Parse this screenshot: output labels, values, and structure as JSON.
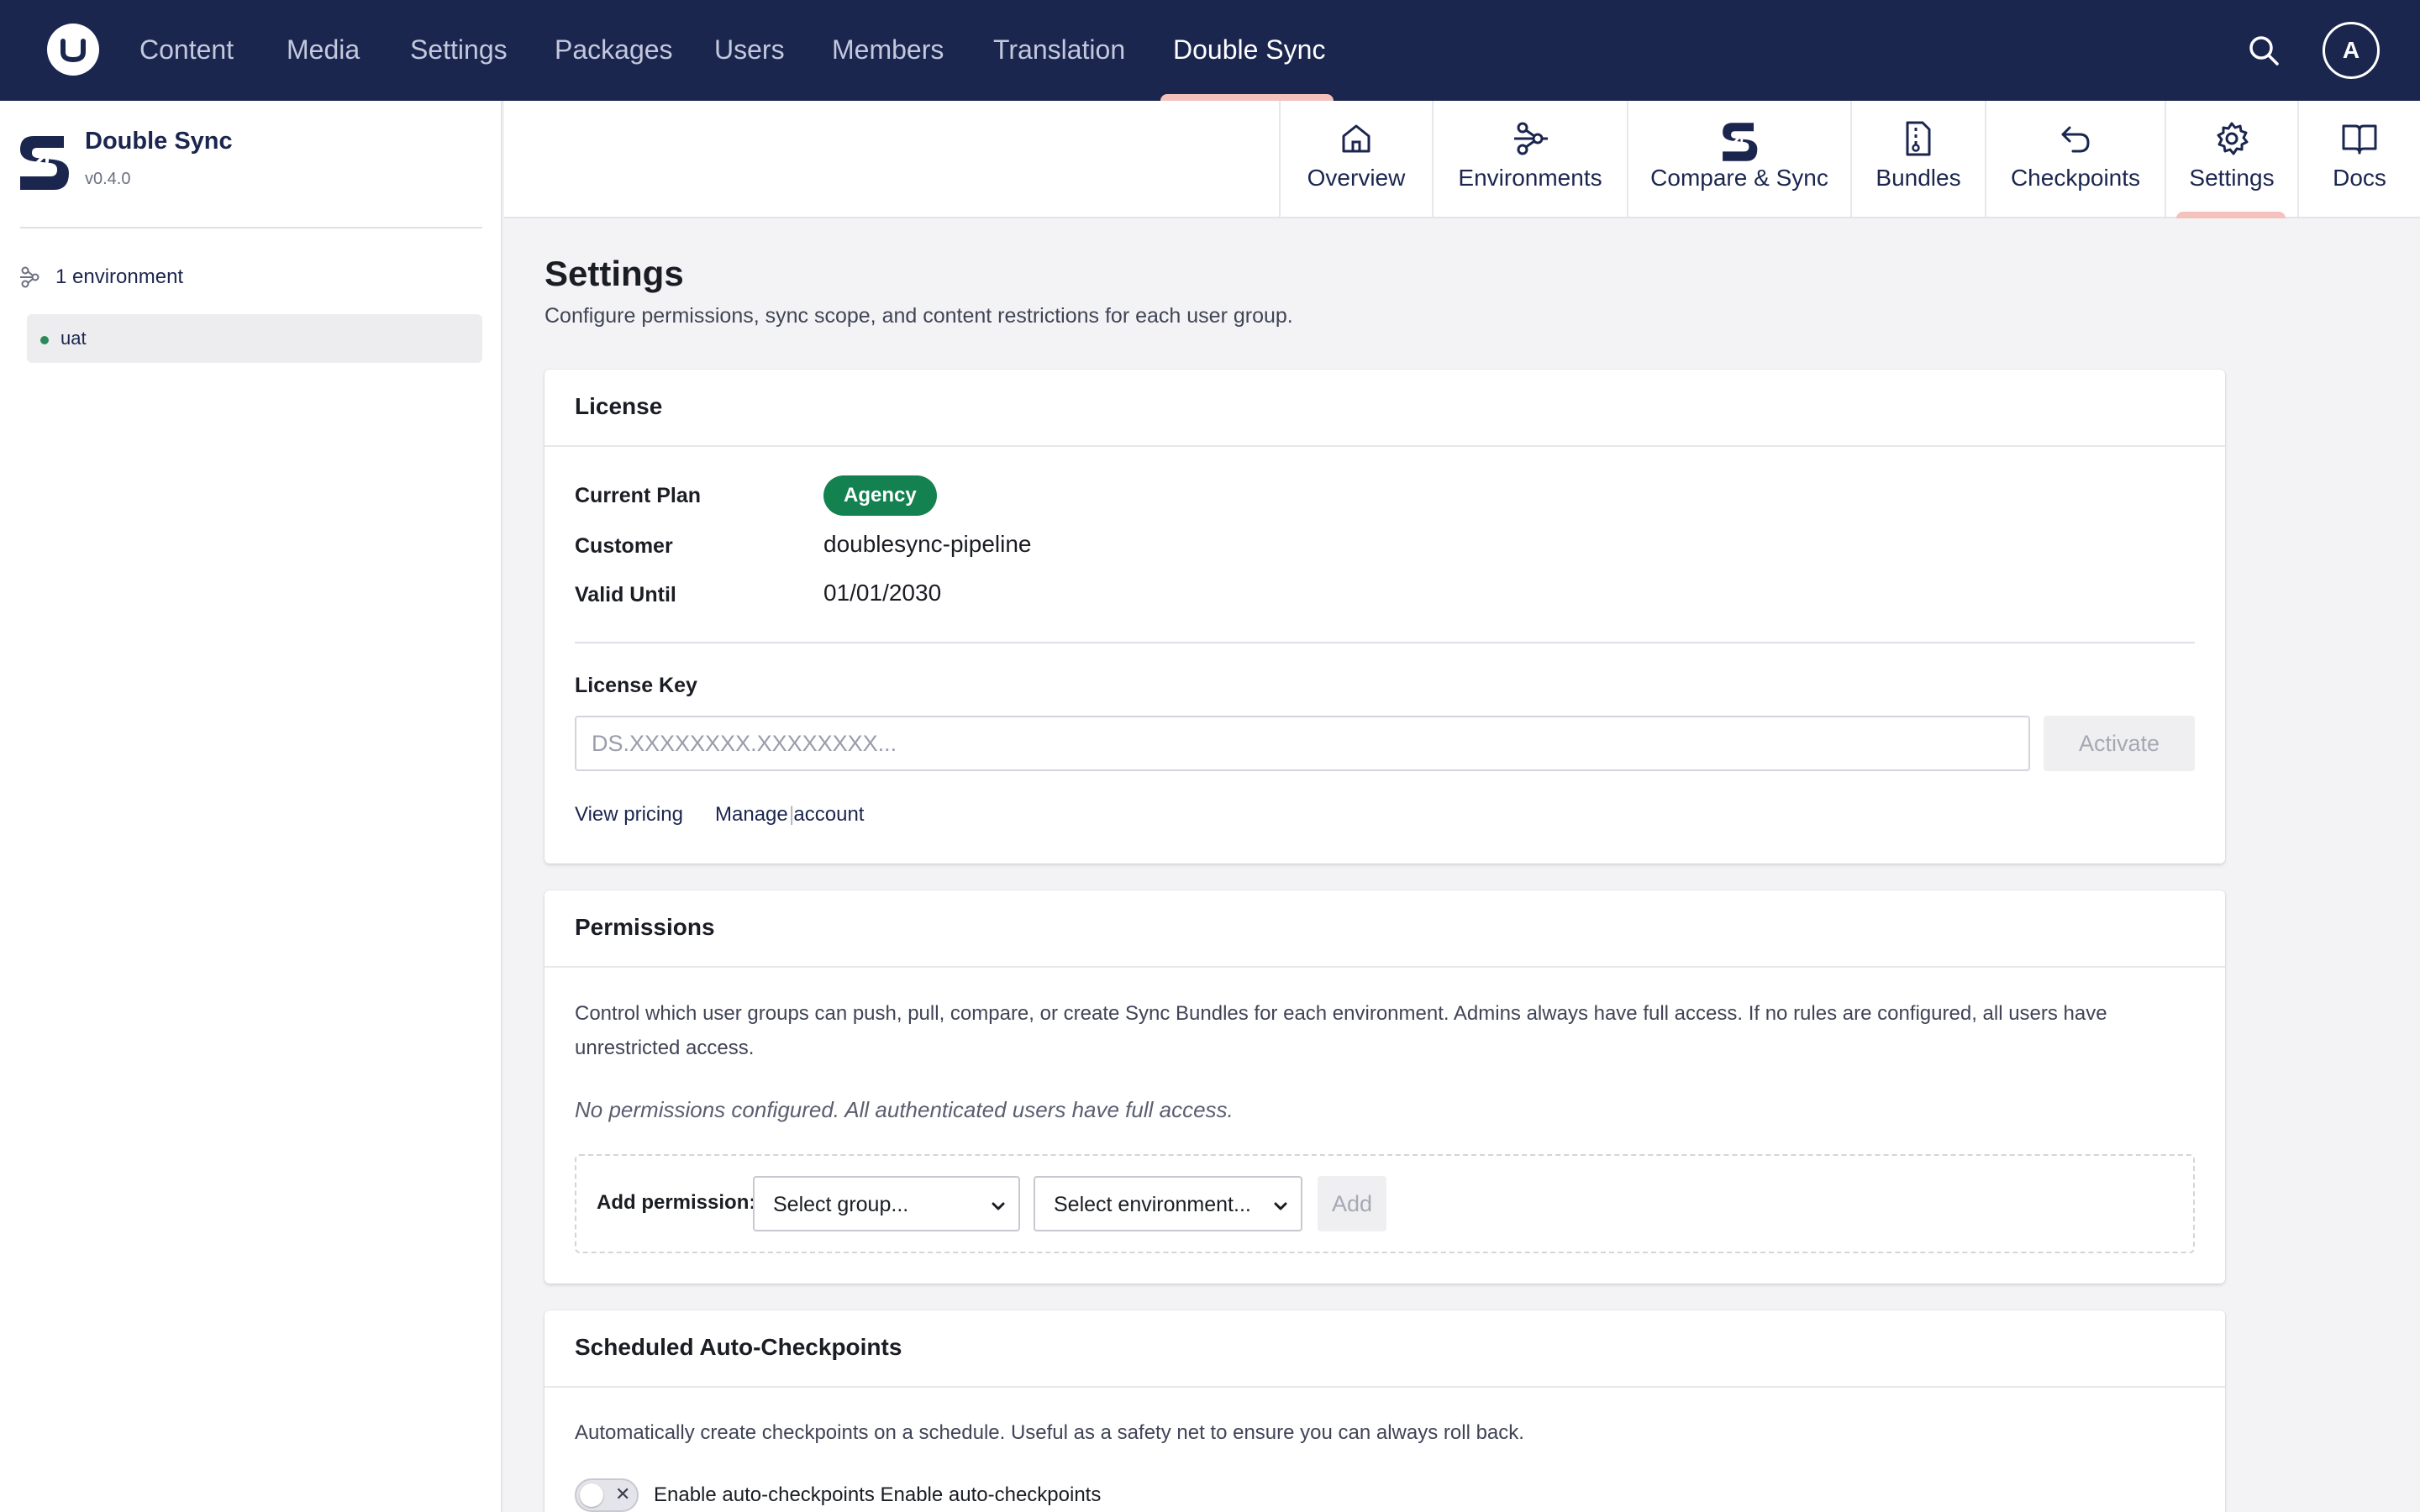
{
  "topnav": {
    "items": [
      "Content",
      "Media",
      "Settings",
      "Packages",
      "Users",
      "Members",
      "Translation",
      "Double Sync"
    ],
    "active": "Double Sync",
    "avatar_initial": "A"
  },
  "sidebar": {
    "app_name": "Double Sync",
    "version": "v0.4.0",
    "environment_count": "1 environment",
    "environments": [
      "uat"
    ]
  },
  "tabs": [
    {
      "label": "Overview",
      "icon": "home-icon"
    },
    {
      "label": "Environments",
      "icon": "environments-icon"
    },
    {
      "label": "Compare & Sync",
      "icon": "double-sync-logo-icon"
    },
    {
      "label": "Bundles",
      "icon": "bundle-file-icon"
    },
    {
      "label": "Checkpoints",
      "icon": "undo-icon"
    },
    {
      "label": "Settings",
      "icon": "gear-icon"
    },
    {
      "label": "Docs",
      "icon": "book-icon"
    }
  ],
  "active_tab": "Settings",
  "page": {
    "title": "Settings",
    "description": "Configure permissions, sync scope, and content restrictions for each user group."
  },
  "license": {
    "title": "License",
    "plan_label": "Current Plan",
    "plan_value": "Agency",
    "customer_label": "Customer",
    "customer_value": "doublesync-pipeline",
    "valid_label": "Valid Until",
    "valid_value": "01/01/2030",
    "key_label": "License Key",
    "key_placeholder": "DS.XXXXXXXX.XXXXXXXX...",
    "activate_label": "Activate",
    "view_pricing": "View pricing",
    "separator": "|",
    "manage_account": "Manage account"
  },
  "permissions": {
    "title": "Permissions",
    "description": "Control which user groups can push, pull, compare, or create Sync Bundles for each environment. Admins always have full access. If no rules are configured, all users have unrestricted access.",
    "empty_message": "No permissions configured. All authenticated users have full access.",
    "add_label": "Add permission:",
    "group_select": "Select group...",
    "environment_select": "Select environment...",
    "add_button": "Add"
  },
  "checkpoints": {
    "title": "Scheduled Auto-Checkpoints",
    "description": "Automatically create checkpoints on a schedule. Useful as a safety net to ensure you can always roll back.",
    "toggle_label": "Enable auto-checkpoints Enable auto-checkpoints",
    "toggle_state": "off"
  },
  "colors": {
    "nav_bg": "#1b264f",
    "accent_underline": "#f5c1bc",
    "badge_green": "#138150",
    "page_bg": "#f3f3f5"
  }
}
